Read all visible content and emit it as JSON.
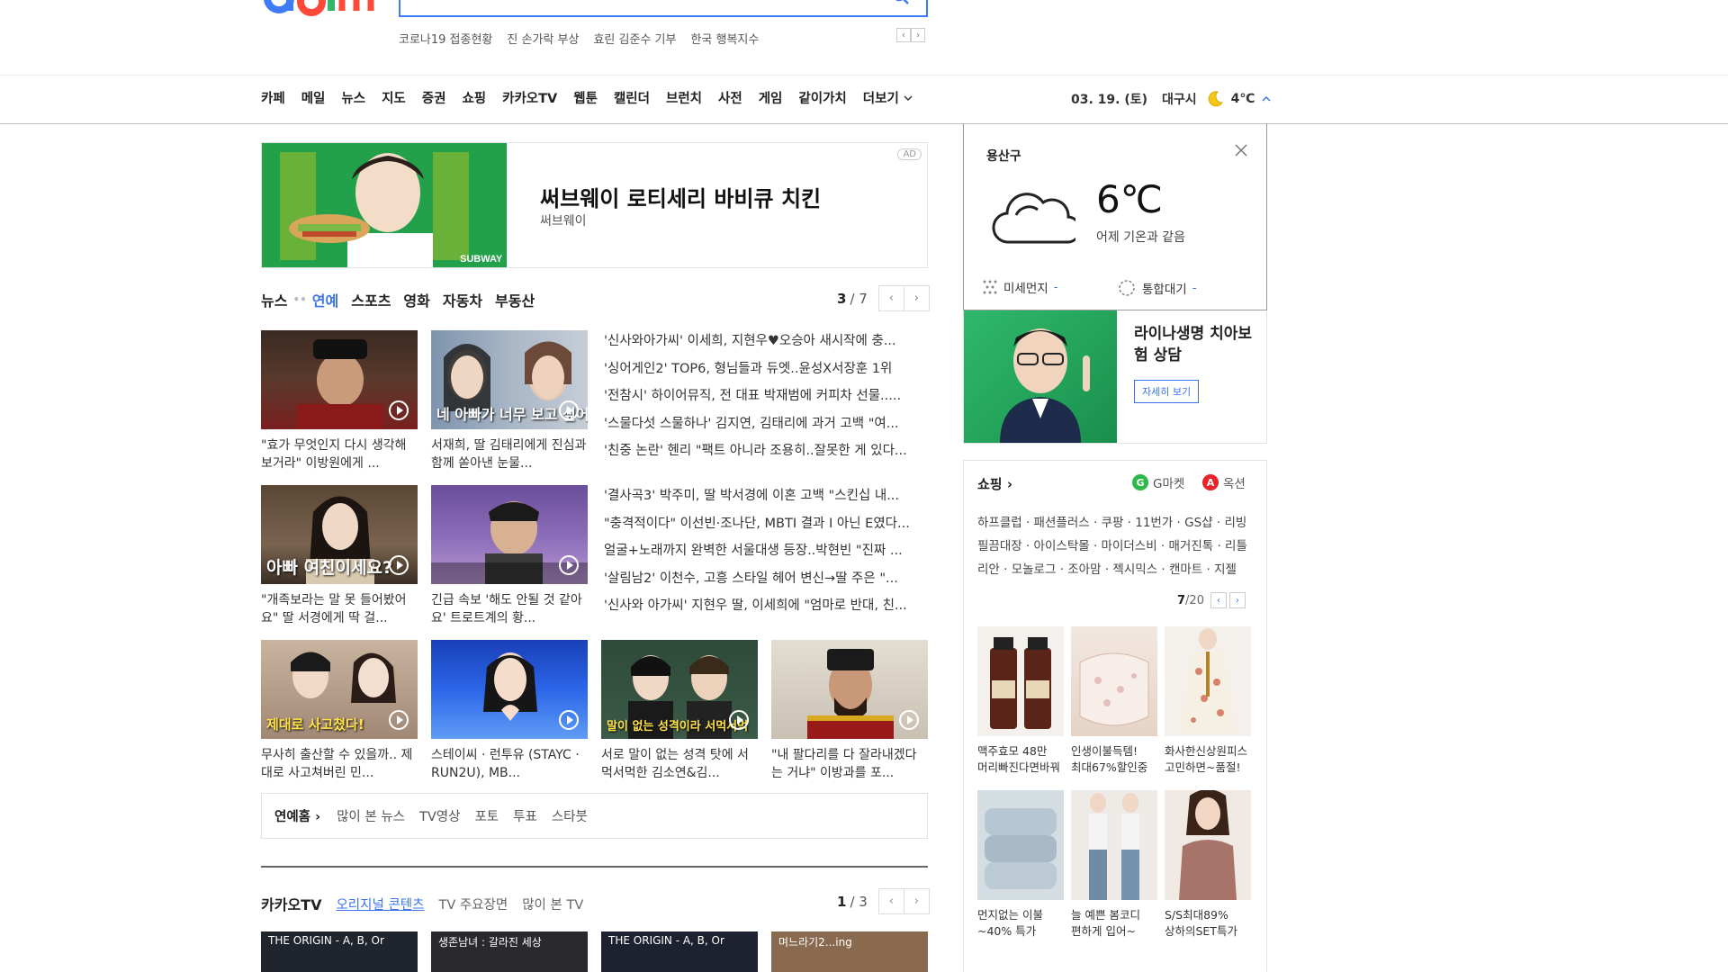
{
  "header": {
    "logo_text": "Daum",
    "rising": [
      "코로나19 접종현황",
      "진 손가락 부상",
      "효린 김준수 기부",
      "한국 행복지수"
    ]
  },
  "colors": {
    "accent": "#3a74e8",
    "logo_blue": "#3e7bf5",
    "logo_red": "#ff4a3a",
    "green": "#28a745"
  },
  "gnb": {
    "items": [
      "카페",
      "메일",
      "뉴스",
      "지도",
      "증권",
      "쇼핑",
      "카카오TV",
      "웹툰",
      "캘린더",
      "브런치",
      "사전",
      "게임",
      "같이가치"
    ],
    "more": "더보기",
    "date": "03. 19. (토)",
    "city": "대구시",
    "temp": "4℃"
  },
  "ad": {
    "title": "써브웨이 로티세리 바비큐 치킨",
    "sub": "써브웨이",
    "mark": "AD"
  },
  "news": {
    "tabs": [
      "뉴스",
      "연예",
      "스포츠",
      "영화",
      "자동차",
      "부동산"
    ],
    "page": "3",
    "total": "7",
    "row1": [
      {
        "cap": "\"효가 무엇인지 다시 생각해 보거라\" 이방원에게 ...",
        "overlay": ""
      },
      {
        "cap": "서재희, 딸 김태리에게 진심과 함께 쏟아낸 눈물...",
        "overlay": "네 아빠가 너무 보고 싶어"
      }
    ],
    "row2": [
      {
        "cap": "\"개족보라는 말 못 들어봤어요\" 딸 서경에게 딱 걸...",
        "overlay": "아빠 여친이세요?"
      },
      {
        "cap": "긴급 속보 '해도 안될 것 같아요' 트로트계의 황...",
        "overlay": ""
      }
    ],
    "row3": [
      {
        "cap": "무사히 출산할 수 있을까.. 제대로 사고쳐버린 민...",
        "overlay": "제대로 사고쳤다!"
      },
      {
        "cap": "스테이씨 · 런투유 (STAYC · RUN2U), MB...",
        "overlay": ""
      },
      {
        "cap": "서로 말이 없는 성격 탓에 서먹서먹한 김소연&김...",
        "overlay": "말이 없는 성격이라 서먹서먹"
      },
      {
        "cap": "\"내 팔다리를 다 잘라내겠다는 거냐\" 이방과를 포...",
        "overlay": ""
      }
    ],
    "headlines1": [
      "'신사와아가씨' 이세희, 지현우♥오승아 새시작에 충...",
      "'싱어게인2' TOP6, 형님들과 듀엣..윤성X서장훈 1위",
      "'전참시' 하이어뮤직, 전 대표 박재범에 커피차 선물.....",
      "'스물다섯 스물하나' 김지연, 김태리에 과거 고백 \"여...",
      "'친중 논란' 헨리 \"팩트 아니라 조용히..잘못한 게 있다..."
    ],
    "headlines2": [
      "'결사곡3' 박주미, 딸 박서경에 이혼 고백 \"스킨십 내...",
      "\"충격적이다\" 이선빈·조나단, MBTI 결과 I 아닌 E였다...",
      "얼굴+노래까지 완벽한 서울대생 등장..박현빈 \"진짜 ...",
      "'살림남2' 이천수, 고흥 스타일 헤어 변신→딸 주은 \"...",
      "'신사와 아가씨' 지현우 딸, 이세희에 \"엄마로 반대, 친..."
    ]
  },
  "ent_bar": {
    "home": "연예홈",
    "links": [
      "많이 본 뉴스",
      "TV영상",
      "포토",
      "투표",
      "스타붓"
    ]
  },
  "kakaotv": {
    "title": "카카오TV",
    "tabs": [
      "오리지널 콘텐츠",
      "TV 주요장면",
      "많이 본 TV"
    ],
    "page": "1",
    "total": "3",
    "thumbs": [
      "THE ORIGIN - A, B, Or",
      "생존남녀 : 갈라진 세상",
      "THE ORIGIN - A, B, Or",
      "며느라기2...ing"
    ]
  },
  "weather": {
    "location": "용산구",
    "temp": "6℃",
    "desc": "어제 기온과 같음",
    "dust_label": "미세먼지",
    "dust_value": "-",
    "air_label": "통합대기",
    "air_value": "-"
  },
  "life_ad": {
    "title": "라이나생명 치아보험 상담",
    "button": "자세히 보기"
  },
  "shopping": {
    "title": "쇼핑",
    "gmarket": "G마켓",
    "auction": "옥션",
    "links": "하프클럽 · 패션플러스 · 쿠팡 · 11번가 · GS샵 · 리빙필끔대장 · 아이스탁몰 · 마이더스비 · 매거진톡 · 리틀리안 · 모놀로그 · 조아맘 · 젝시믹스 · 캔마트 · 지젤",
    "page": "7",
    "total": "/20",
    "products": [
      {
        "line1": "맥주효모 48만",
        "line2": "머리빠진다면바꿔"
      },
      {
        "line1": "인생이불득템!",
        "line2": "최대67%할인중"
      },
      {
        "line1": "화사한신상원피스",
        "line2": "고민하면~품절!"
      },
      {
        "line1": "먼지없는 이불",
        "line2": "~40% 특가"
      },
      {
        "line1": "늘 예쁜 봄코디",
        "line2": "편하게 입어~"
      },
      {
        "line1": "S/S최대89%",
        "line2": "상하의SET특가"
      }
    ]
  }
}
